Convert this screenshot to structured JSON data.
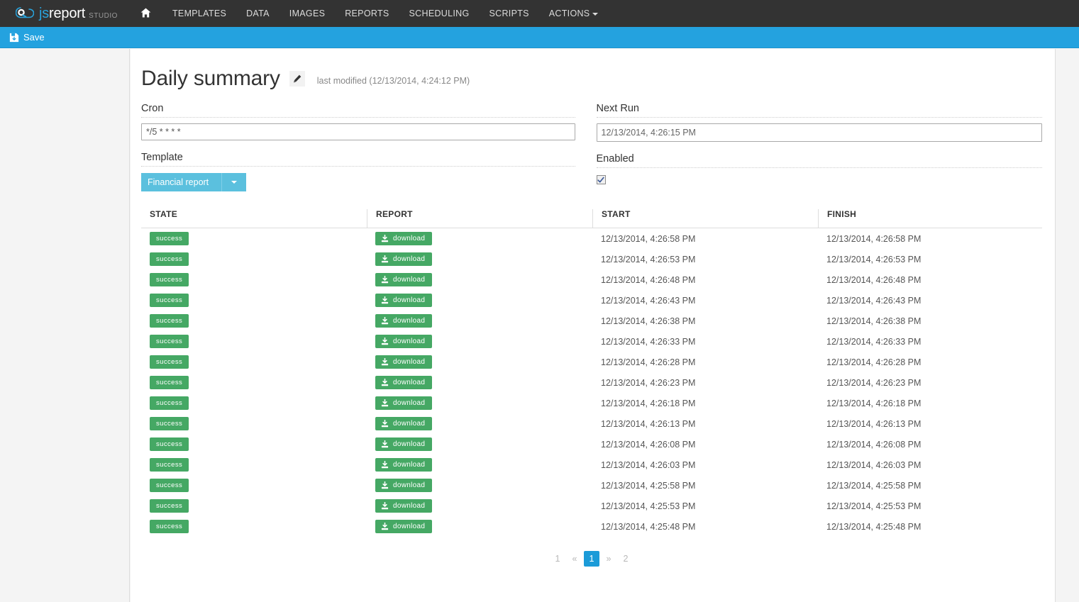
{
  "brand": {
    "js": "js",
    "report": "report",
    "studio": "STUDIO"
  },
  "nav": {
    "home_icon": "home-icon",
    "items": [
      {
        "label": "TEMPLATES",
        "caret": false
      },
      {
        "label": "DATA",
        "caret": false
      },
      {
        "label": "IMAGES",
        "caret": false
      },
      {
        "label": "REPORTS",
        "caret": false
      },
      {
        "label": "SCHEDULING",
        "caret": false
      },
      {
        "label": "SCRIPTS",
        "caret": false
      },
      {
        "label": "ACTIONS",
        "caret": true
      }
    ]
  },
  "toolbar": {
    "save_label": "Save",
    "save_icon": "floppy-disk-icon"
  },
  "header": {
    "title": "Daily summary",
    "edit_icon": "pencil-icon",
    "last_modified": "last modified (12/13/2014, 4:24:12 PM)"
  },
  "form": {
    "cron_label": "Cron",
    "cron_value": "*/5 * * * *",
    "cron_placeholder": "*/5 * * * *",
    "template_label": "Template",
    "template_value": "Financial report",
    "template_caret_icon": "chevron-down-icon",
    "next_run_label": "Next Run",
    "next_run_value": "12/13/2014, 4:26:15 PM",
    "enabled_label": "Enabled",
    "enabled_checked": true,
    "check_icon": "check-icon"
  },
  "table": {
    "columns": [
      "STATE",
      "REPORT",
      "START",
      "FINISH"
    ],
    "download_label": "download",
    "download_icon": "download-icon",
    "rows": [
      {
        "state": "success",
        "start": "12/13/2014, 4:26:58 PM",
        "finish": "12/13/2014, 4:26:58 PM"
      },
      {
        "state": "success",
        "start": "12/13/2014, 4:26:53 PM",
        "finish": "12/13/2014, 4:26:53 PM"
      },
      {
        "state": "success",
        "start": "12/13/2014, 4:26:48 PM",
        "finish": "12/13/2014, 4:26:48 PM"
      },
      {
        "state": "success",
        "start": "12/13/2014, 4:26:43 PM",
        "finish": "12/13/2014, 4:26:43 PM"
      },
      {
        "state": "success",
        "start": "12/13/2014, 4:26:38 PM",
        "finish": "12/13/2014, 4:26:38 PM"
      },
      {
        "state": "success",
        "start": "12/13/2014, 4:26:33 PM",
        "finish": "12/13/2014, 4:26:33 PM"
      },
      {
        "state": "success",
        "start": "12/13/2014, 4:26:28 PM",
        "finish": "12/13/2014, 4:26:28 PM"
      },
      {
        "state": "success",
        "start": "12/13/2014, 4:26:23 PM",
        "finish": "12/13/2014, 4:26:23 PM"
      },
      {
        "state": "success",
        "start": "12/13/2014, 4:26:18 PM",
        "finish": "12/13/2014, 4:26:18 PM"
      },
      {
        "state": "success",
        "start": "12/13/2014, 4:26:13 PM",
        "finish": "12/13/2014, 4:26:13 PM"
      },
      {
        "state": "success",
        "start": "12/13/2014, 4:26:08 PM",
        "finish": "12/13/2014, 4:26:08 PM"
      },
      {
        "state": "success",
        "start": "12/13/2014, 4:26:03 PM",
        "finish": "12/13/2014, 4:26:03 PM"
      },
      {
        "state": "success",
        "start": "12/13/2014, 4:25:58 PM",
        "finish": "12/13/2014, 4:25:58 PM"
      },
      {
        "state": "success",
        "start": "12/13/2014, 4:25:53 PM",
        "finish": "12/13/2014, 4:25:53 PM"
      },
      {
        "state": "success",
        "start": "12/13/2014, 4:25:48 PM",
        "finish": "12/13/2014, 4:25:48 PM"
      }
    ]
  },
  "pagination": {
    "items": [
      {
        "label": "1",
        "active": false,
        "name": "page-first"
      },
      {
        "label": "«",
        "active": false,
        "name": "page-prev"
      },
      {
        "label": "1",
        "active": true,
        "name": "page-1"
      },
      {
        "label": "»",
        "active": false,
        "name": "page-next"
      },
      {
        "label": "2",
        "active": false,
        "name": "page-2"
      }
    ]
  },
  "colors": {
    "navbar": "#333333",
    "accent": "#24a2df",
    "template_button": "#5bc0de",
    "success": "#45a864",
    "pager_active": "#1b9bd8"
  }
}
